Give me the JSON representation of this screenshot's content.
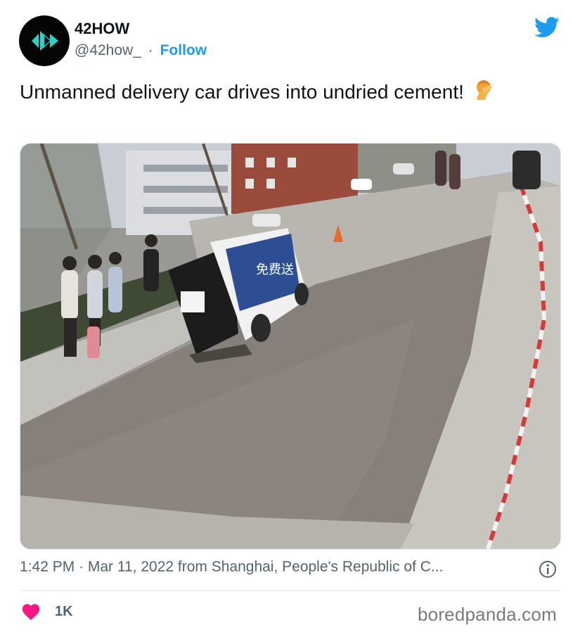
{
  "account": {
    "display_name": "42HOW",
    "handle": "@42how_",
    "separator": "·",
    "follow_label": "Follow",
    "avatar_icon": "42how-logo-icon"
  },
  "platform_icon": "twitter-bird-icon",
  "tweet": {
    "text": "Unmanned delivery car drives into undried cement!",
    "emoji_icon": "face-palm-emoji-icon"
  },
  "photo": {
    "description_icon": "delivery-car-in-cement-photo",
    "sign_text": "免费送"
  },
  "meta": {
    "timestamp": "1:42 PM · Mar 11, 2022 from Shanghai, People's Republic of C...",
    "info_icon": "info-icon"
  },
  "engagement": {
    "likes": "1K",
    "heart_color": "#f91880"
  },
  "watermark": "boredpanda.com",
  "colors": {
    "accent": "#1d9bf0",
    "text": "#0f1419",
    "secondary": "#536471"
  }
}
